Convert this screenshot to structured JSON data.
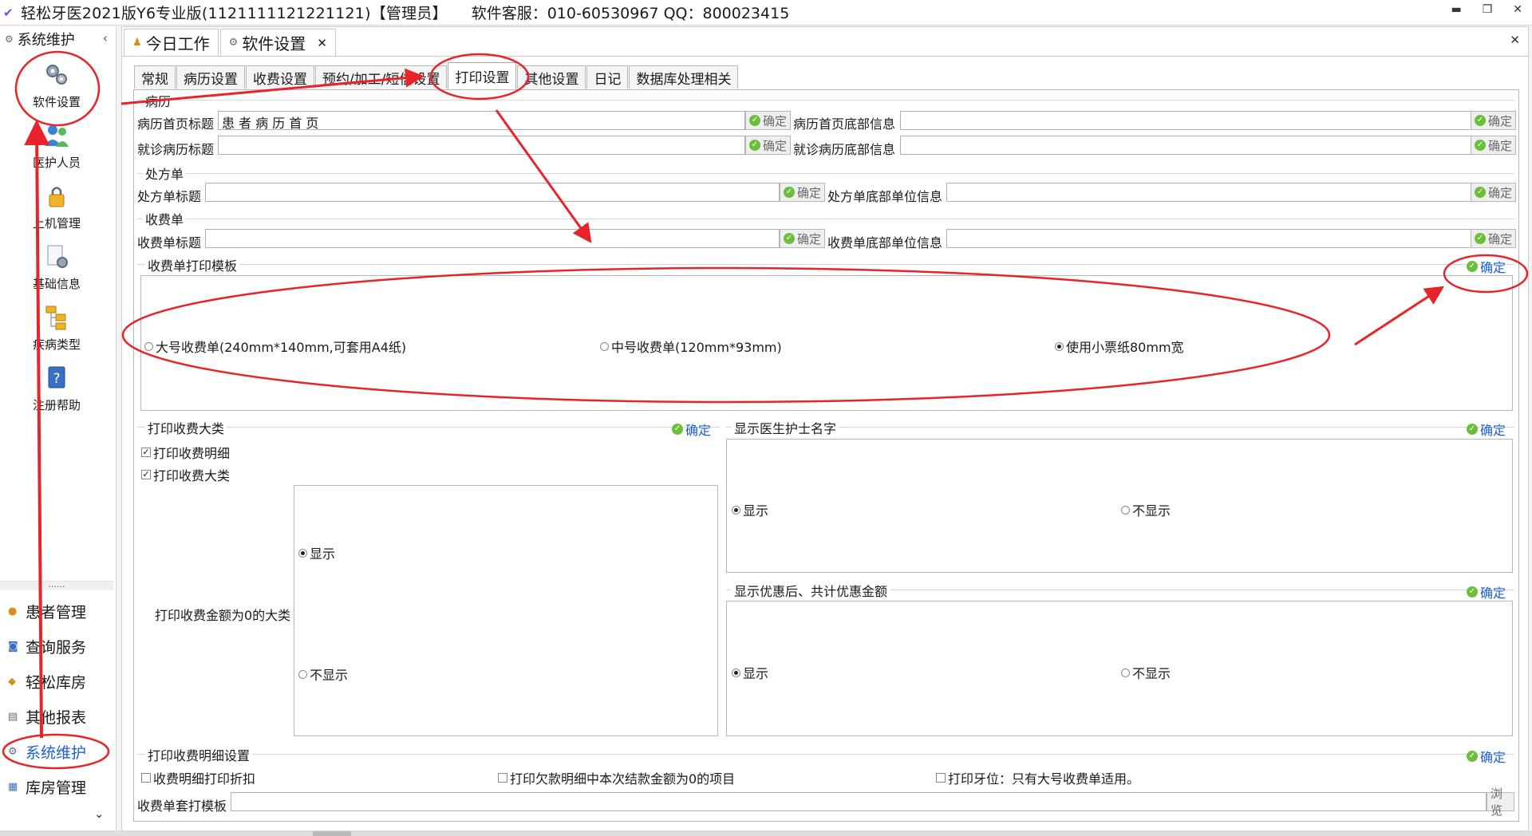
{
  "titlebar": {
    "title": "轻松牙医2021版Y6专业版(1121111121221121)【管理员】",
    "support": "软件客服：010-60530967 QQ：800023415"
  },
  "sidebar": {
    "header": "系统维护",
    "tiles": [
      {
        "label": "软件设置"
      },
      {
        "label": "医护人员"
      },
      {
        "label": "上机管理"
      },
      {
        "label": "基础信息"
      },
      {
        "label": "疾病类型"
      },
      {
        "label": "注册帮助"
      }
    ],
    "dots": "......",
    "nav": [
      {
        "label": "患者管理"
      },
      {
        "label": "查询服务"
      },
      {
        "label": "轻松库房"
      },
      {
        "label": "其他报表"
      },
      {
        "label": "系统维护"
      },
      {
        "label": "库房管理"
      }
    ]
  },
  "doc_tabs": [
    {
      "label": "今日工作"
    },
    {
      "label": "软件设置"
    }
  ],
  "sub_tabs": [
    "常规",
    "病历设置",
    "收费设置",
    "预约/加工/短信设置",
    "打印设置",
    "其他设置",
    "日记",
    "数据库处理相关"
  ],
  "ok_label": "确定",
  "browse_label": "浏览",
  "record": {
    "title": "病历",
    "home_title_label": "病历首页标题",
    "home_title_value": "患 者 病 历 首 页",
    "home_footer_label": "病历首页底部信息",
    "visit_title_label": "就诊病历标题",
    "visit_footer_label": "就诊病历底部信息"
  },
  "prescription": {
    "title": "处方单",
    "title_label": "处方单标题",
    "footer_label": "处方单底部单位信息"
  },
  "receipt": {
    "title": "收费单",
    "title_label": "收费单标题",
    "footer_label": "收费单底部单位信息"
  },
  "template": {
    "title": "收费单打印模板",
    "options": [
      "大号收费单(240mm*140mm,可套用A4纸)",
      "中号收费单(120mm*93mm)",
      "使用小票纸80mm宽"
    ],
    "selected": 2
  },
  "category": {
    "title": "打印收费大类",
    "checks": [
      "打印收费明细",
      "打印收费大类"
    ],
    "zero_label": "打印收费金额为0的大类",
    "show": "显示",
    "hide": "不显示"
  },
  "doctor_names": {
    "title": "显示医生护士名字",
    "show": "显示",
    "hide": "不显示"
  },
  "discount": {
    "title": "显示优惠后、共计优惠金额",
    "show": "显示",
    "hide": "不显示"
  },
  "detail": {
    "title": "打印收费明细设置",
    "options": [
      "收费明细打印折扣",
      "打印欠款明细中本次结款金额为0的项目",
      "打印牙位：只有大号收费单适用。"
    ],
    "template_label": "收费单套打模板"
  },
  "colors": {
    "accent": "#1c5fd0",
    "annotation": "#e8242a",
    "ok_green": "#6cbf3b"
  }
}
